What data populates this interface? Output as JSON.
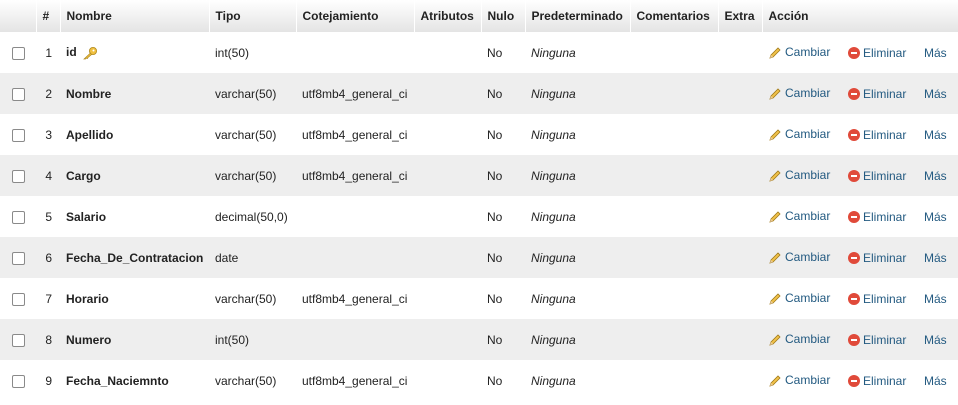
{
  "headers": {
    "index": "#",
    "name": "Nombre",
    "type": "Tipo",
    "collation": "Cotejamiento",
    "attributes": "Atributos",
    "null": "Nulo",
    "default": "Predeterminado",
    "comments": "Comentarios",
    "extra": "Extra",
    "action": "Acción"
  },
  "actions": {
    "change": "Cambiar",
    "drop": "Eliminar",
    "more": "Más"
  },
  "rows": [
    {
      "num": "1",
      "name": "id",
      "type": "int(50)",
      "collation": "",
      "null": "No",
      "default": "Ninguna",
      "primary_key": true
    },
    {
      "num": "2",
      "name": "Nombre",
      "type": "varchar(50)",
      "collation": "utf8mb4_general_ci",
      "null": "No",
      "default": "Ninguna"
    },
    {
      "num": "3",
      "name": "Apellido",
      "type": "varchar(50)",
      "collation": "utf8mb4_general_ci",
      "null": "No",
      "default": "Ninguna"
    },
    {
      "num": "4",
      "name": "Cargo",
      "type": "varchar(50)",
      "collation": "utf8mb4_general_ci",
      "null": "No",
      "default": "Ninguna"
    },
    {
      "num": "5",
      "name": "Salario",
      "type": "decimal(50,0)",
      "collation": "",
      "null": "No",
      "default": "Ninguna"
    },
    {
      "num": "6",
      "name": "Fecha_De_Contratacion",
      "type": "date",
      "collation": "",
      "null": "No",
      "default": "Ninguna"
    },
    {
      "num": "7",
      "name": "Horario",
      "type": "varchar(50)",
      "collation": "utf8mb4_general_ci",
      "null": "No",
      "default": "Ninguna"
    },
    {
      "num": "8",
      "name": "Numero",
      "type": "int(50)",
      "collation": "",
      "null": "No",
      "default": "Ninguna"
    },
    {
      "num": "9",
      "name": "Fecha_Naciemnto",
      "type": "varchar(50)",
      "collation": "utf8mb4_general_ci",
      "null": "No",
      "default": "Ninguna"
    }
  ],
  "colors": {
    "link": "#235a81",
    "row_alt": "#eeeeee",
    "drop_icon": "#e04a3a"
  },
  "icons": {
    "primary_key": "key-icon",
    "change": "pencil-icon",
    "drop": "minus-circle-icon"
  }
}
